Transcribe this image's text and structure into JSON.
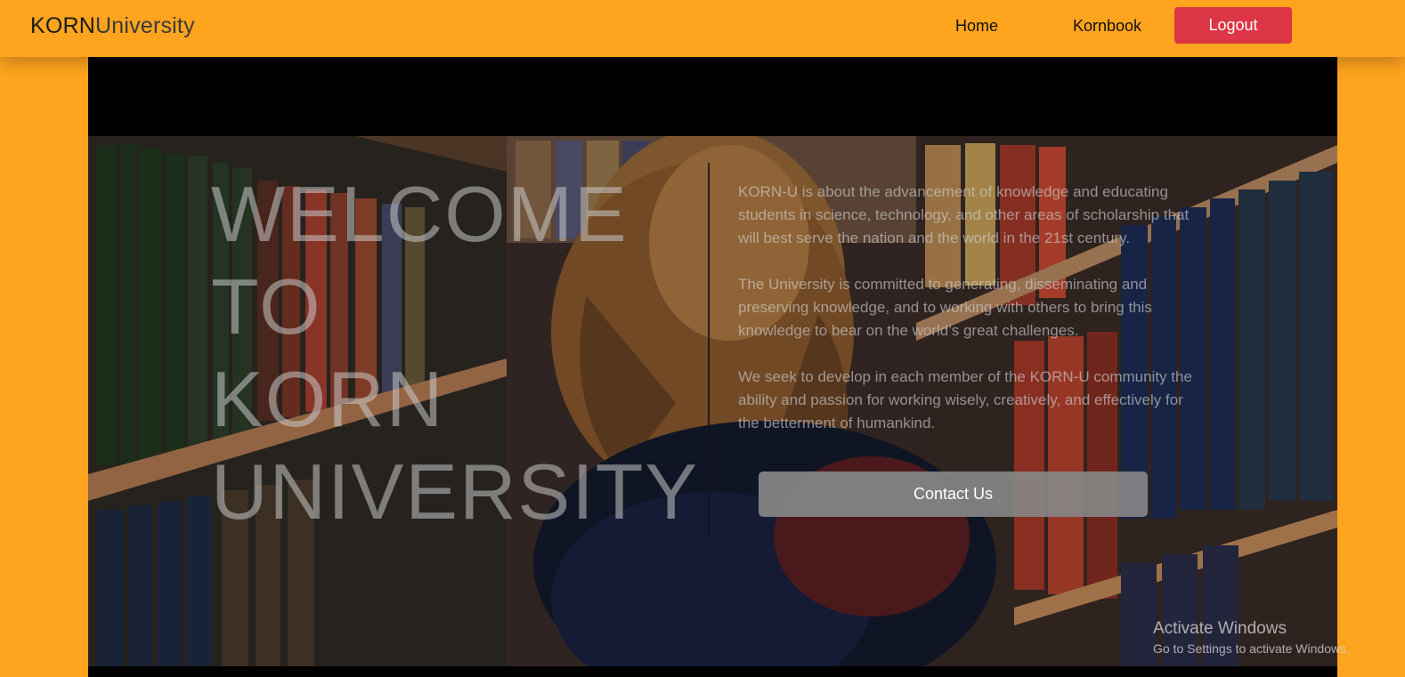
{
  "navbar": {
    "brand_bold": "KORN",
    "brand_light": "University",
    "links": [
      {
        "label": "Home"
      },
      {
        "label": "Kornbook"
      }
    ],
    "logout_label": "Logout",
    "logout_color": "#DC3545",
    "background_color": "#FFA41E"
  },
  "hero": {
    "welcome_lines": [
      "WELCOME",
      "TO",
      "KORN",
      "UNIVERSITY"
    ],
    "paragraphs": [
      "KORN-U is about the advancement of knowledge and educating students in science, technology, and other areas of scholarship that will best serve the nation and the world in the 21st century.",
      "The University is committed to generating, disseminating and preserving knowledge, and to working with others to bring this knowledge to bear on the world’s great challenges.",
      "We seek to develop in each member of the KORN-U community the ability and passion for working wisely, creatively, and effectively for the betterment of humankind."
    ],
    "contact_label": "Contact Us"
  },
  "os_watermark": {
    "title": "Activate Windows",
    "subtitle": "Go to Settings to activate Windows."
  }
}
